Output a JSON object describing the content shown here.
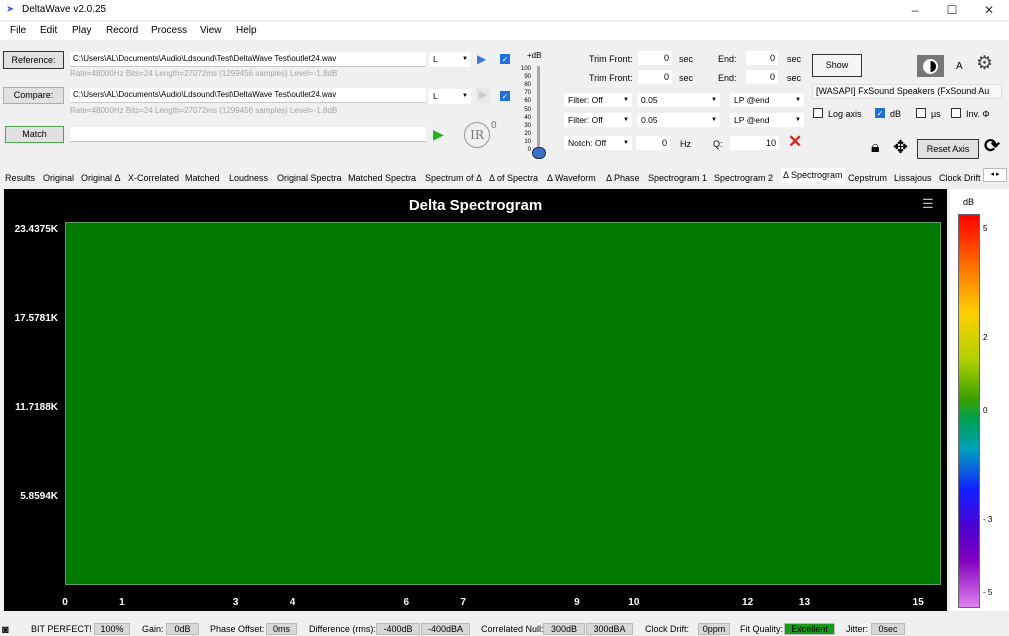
{
  "window": {
    "title": "DeltaWave v2.0.25",
    "minimize": "–",
    "maximize": "☐",
    "close": "✕"
  },
  "menu": [
    "File",
    "Edit",
    "Play",
    "Record",
    "Process",
    "View",
    "Help"
  ],
  "reference": {
    "button": "Reference:",
    "path": "C:\\Users\\AL\\Documents\\Audio\\Ldsound\\Test\\DeltaWave Test\\outlet24.wav",
    "channel": "L",
    "info": "Rate=48000Hz Bits=24 Length=27072ms (1299456 samples) Level=-1.8dB"
  },
  "compare": {
    "button": "Compare:",
    "path": "C:\\Users\\AL\\Documents\\Audio\\Ldsound\\Test\\DeltaWave Test\\outlet24.wav",
    "channel": "L",
    "info": "Rate=48000Hz Bits=24 Length=27072ms (1299456 samples) Level=-1.8dB"
  },
  "match": {
    "button": "Match",
    "ir_label": "IR",
    "ir_sup": "0"
  },
  "level": {
    "title": "+dB",
    "ticks": [
      "100",
      "90",
      "80",
      "70",
      "60",
      "50",
      "40",
      "30",
      "20",
      "10",
      "0"
    ]
  },
  "trim": {
    "ref_front_label": "Trim Front:",
    "ref_front": "0",
    "ref_sec": "sec",
    "ref_end_label": "End:",
    "ref_end": "0",
    "ref_end_sec": "sec",
    "cmp_front_label": "Trim Front:",
    "cmp_front": "0",
    "cmp_sec": "sec",
    "cmp_end_label": "End:",
    "cmp_end": "0",
    "cmp_end_sec": "sec"
  },
  "filters": {
    "f1": "Filter: Off",
    "f1_val": "0.05",
    "f1_lp": "LP @end",
    "f2": "Filter: Off",
    "f2_val": "0.05",
    "f2_lp": "LP @end",
    "notch": "Notch: Off",
    "notch_val": "0",
    "hz": "Hz",
    "q_label": "Q:",
    "q_val": "10"
  },
  "right": {
    "show": "Show",
    "a_label": "A",
    "device": "[WASAPI] FxSound Speakers (FxSound Au",
    "log_axis": "Log axis",
    "db": "dB",
    "us": "µs",
    "inv": "Inv. Φ",
    "reset_axis": "Reset Axis"
  },
  "tabs": [
    "Results",
    "Original",
    "Original Δ",
    "X-Correlated",
    "Matched",
    "Loudness",
    "Original Spectra",
    "Matched Spectra",
    "Spectrum of Δ",
    "Δ of Spectra",
    "Δ Waveform",
    "Δ Phase",
    "Spectrogram 1",
    "Spectrogram 2",
    "Δ Spectrogram",
    "Cepstrum",
    "Lissajous",
    "Clock Drift"
  ],
  "chart_data": {
    "type": "heatmap",
    "title": "Delta Spectrogram",
    "x_ticks": [
      "0",
      "1",
      "3",
      "4",
      "6",
      "7",
      "9",
      "10",
      "12",
      "13",
      "15"
    ],
    "y_ticks": [
      "23.4375K",
      "17.5781K",
      "11.7188K",
      "5.8594K"
    ],
    "colorbar_title": "dB",
    "colorbar_ticks": [
      "5",
      "2",
      "0",
      "- 3",
      "- 5"
    ],
    "fill_value_db": 0
  },
  "status": {
    "bit_perfect": "BIT PERFECT!",
    "bit_perfect_val": "100%",
    "gain": "Gain:",
    "gain_val": "0dB",
    "phase": "Phase Offset:",
    "phase_val": "0ms",
    "diff": "Difference (rms):",
    "diff_val1": "-400dB",
    "diff_val2": "-400dBA",
    "corr": "Correlated Null:",
    "corr_val1": "300dB",
    "corr_val2": "300dBA",
    "drift": "Clock Drift:",
    "drift_val": "0ppm",
    "fit": "Fit Quality:",
    "fit_val": "Excellent",
    "jitter": "Jitter:",
    "jitter_val": "0sec"
  }
}
